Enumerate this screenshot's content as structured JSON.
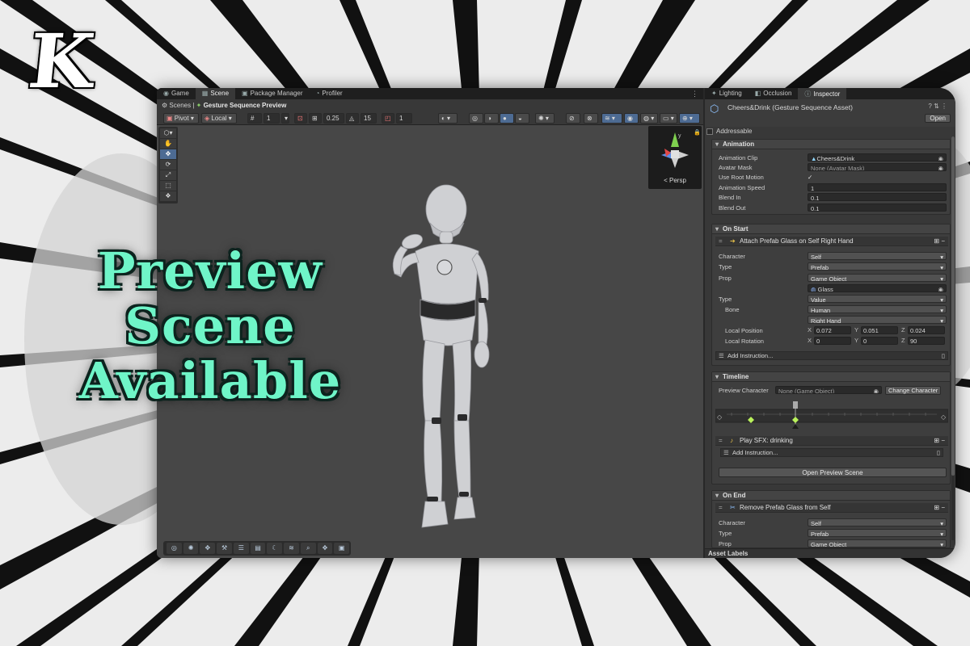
{
  "brand": {
    "logo_letter": "K"
  },
  "headline": {
    "line1": "Preview Scene",
    "line2": "Available"
  },
  "editor": {
    "tabs": [
      {
        "label": "Game",
        "icon": "gamepad-icon"
      },
      {
        "label": "Scene",
        "icon": "grid-icon"
      },
      {
        "label": "Package Manager",
        "icon": "package-icon"
      },
      {
        "label": "Profiler",
        "icon": "profiler-icon"
      }
    ],
    "breadcrumb": {
      "root": "Scenes",
      "current": "Gesture Sequence Preview"
    },
    "toolbar": {
      "pivot": "Pivot",
      "local": "Local",
      "grid_value": "1",
      "snap_value": "0.25",
      "angle_value": "15",
      "scale_value": "1"
    },
    "gizmo": {
      "label": "< Persp"
    }
  },
  "inspector": {
    "tabs": [
      {
        "label": "Lighting",
        "icon": "bulb-icon"
      },
      {
        "label": "Occlusion",
        "icon": "occlusion-icon"
      },
      {
        "label": "Inspector",
        "icon": "info-icon"
      }
    ],
    "title": "Cheers&Drink (Gesture Sequence Asset)",
    "open_label": "Open",
    "addressable_label": "Addressable",
    "animation": {
      "header": "Animation",
      "rows": [
        {
          "label": "Animation Clip",
          "value": "Cheers&Drink"
        },
        {
          "label": "Avatar Mask",
          "value": "None (Avatar Mask)"
        },
        {
          "label": "Use Root Motion",
          "value": "✓"
        },
        {
          "label": "Animation Speed",
          "value": "1"
        },
        {
          "label": "Blend In",
          "value": "0.1"
        },
        {
          "label": "Blend Out",
          "value": "0.1"
        }
      ]
    },
    "on_start": {
      "header": "On Start",
      "instruction": "Attach Prefab Glass on Self Right Hand",
      "rows": [
        {
          "label": "Character",
          "value": "Self"
        },
        {
          "label": "Type",
          "value": "Prefab"
        },
        {
          "label": "Prop",
          "value": "Game Object"
        },
        {
          "label": "",
          "value": "Glass"
        },
        {
          "label": "Type",
          "value": "Value"
        },
        {
          "label": "Bone",
          "value": "Human"
        },
        {
          "label": "",
          "value": "Right Hand"
        }
      ],
      "local_position": {
        "label": "Local Position",
        "x": "0.072",
        "y": "0.051",
        "z": "0.024"
      },
      "local_rotation": {
        "label": "Local Rotation",
        "x": "0",
        "y": "0",
        "z": "90"
      },
      "add_instruction": "Add Instruction..."
    },
    "timeline": {
      "header": "Timeline",
      "preview_character_label": "Preview Character",
      "preview_character_value": "None (Game Object)",
      "change_character": "Change Character",
      "instruction": "Play SFX: drinking",
      "add_instruction": "Add Instruction...",
      "open_preview": "Open Preview Scene"
    },
    "on_end": {
      "header": "On End",
      "instruction": "Remove Prefab Glass from Self",
      "rows": [
        {
          "label": "Character",
          "value": "Self"
        },
        {
          "label": "Type",
          "value": "Prefab"
        },
        {
          "label": "Prop",
          "value": "Game Object"
        }
      ]
    },
    "asset_labels": "Asset Labels"
  },
  "colors": {
    "headline": "#6ff5c8",
    "editor_bg": "#282828",
    "accent": "#4d6b93",
    "keyframe": "#b9f15b"
  }
}
